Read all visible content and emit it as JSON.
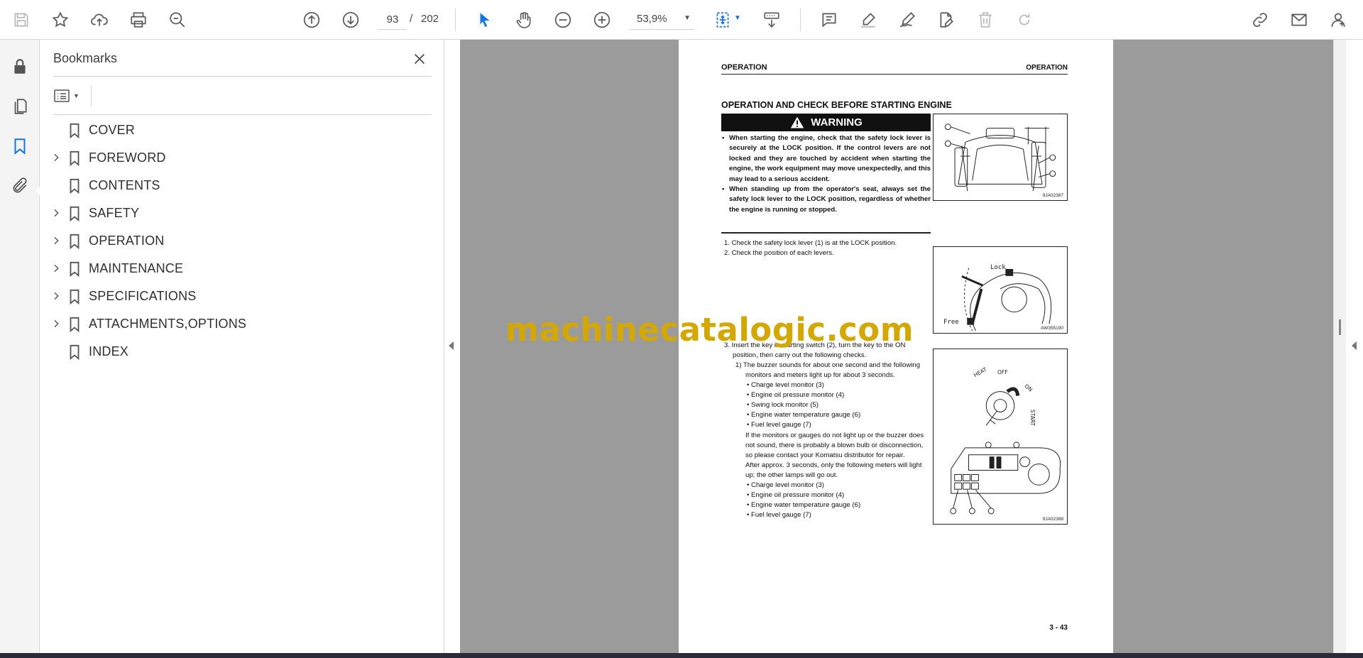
{
  "toolbar": {
    "page_current": "93",
    "page_separator": "/",
    "page_total": "202",
    "zoom": "53,9%"
  },
  "bookmarks": {
    "title": "Bookmarks",
    "items": [
      {
        "label": "COVER",
        "expandable": false
      },
      {
        "label": "FOREWORD",
        "expandable": true
      },
      {
        "label": "CONTENTS",
        "expandable": false
      },
      {
        "label": "SAFETY",
        "expandable": true
      },
      {
        "label": "OPERATION",
        "expandable": true
      },
      {
        "label": "MAINTENANCE",
        "expandable": true
      },
      {
        "label": "SPECIFICATIONS",
        "expandable": true
      },
      {
        "label": "ATTACHMENTS,OPTIONS",
        "expandable": true
      },
      {
        "label": "INDEX",
        "expandable": false
      }
    ]
  },
  "page": {
    "header_left": "OPERATION",
    "header_right": "OPERATION",
    "title": "OPERATION AND CHECK BEFORE STARTING ENGINE",
    "warning_label": "WARNING",
    "warnings": [
      "When starting the engine, check that the safety lock lever is securely at the LOCK position. If the control levers are not locked and they are touched by accident when starting the engine, the work equipment may move unexpectedly, and this may lead to a serious accident.",
      "When standing up from the operator's seat, always set the safety lock lever to the LOCK position, regardless of whether the engine is running or stopped."
    ],
    "steps": {
      "s1": "1. Check the safety lock lever (1) is at the LOCK position.",
      "s2": "2. Check the position of each levers.",
      "s3a": "3. Insert the key in starting switch (2), turn the key to the ON",
      "s3b": "position, then carry out the following checks.",
      "s3_1a": "1) The buzzer sounds for about one second and the following",
      "s3_1b": "monitors and meters light up for about 3 seconds.",
      "list1": [
        "Charge level monitor (3)",
        "Engine oil pressure monitor (4)",
        "Swing lock monitor (5)",
        "Engine water temperature gauge (6)",
        "Fuel level gauge (7)"
      ],
      "note1": "If the monitors or gauges do not light up or the buzzer does",
      "note2": "not sound, there is probably a blown bulb or disconnection,",
      "note3": "so please contact your Komatsu distributor for repair.",
      "note4": "After approx. 3 seconds, only the following meters will light",
      "note5": "up; the other lamps will go out.",
      "list2": [
        "Charge level monitor (3)",
        "Engine oil pressure monitor (4)",
        "Engine water temperature gauge (6)",
        "Fuel level gauge (7)"
      ]
    },
    "fig1_code": "9JA02387",
    "fig2_code": "AW355190",
    "fig2_lock": "Lock",
    "fig2_free": "Free",
    "fig3_code": "9JA02388",
    "fig3_heat": "HEAT",
    "fig3_off": "OFF",
    "fig3_on": "ON",
    "fig3_start": "START",
    "page_number": "3 - 43"
  },
  "watermark": "machinecatalogic.com",
  "colors": {
    "accent": "#1473e6",
    "watermark": "#d4a800",
    "viewer_bg": "#9b9b9b"
  }
}
